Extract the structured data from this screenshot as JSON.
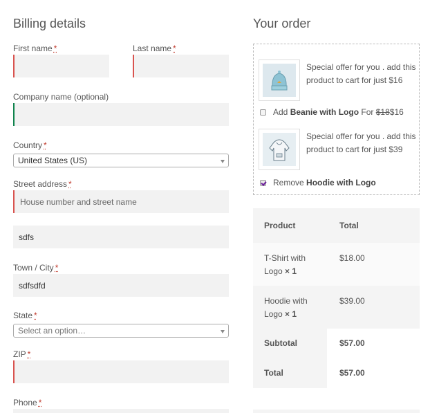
{
  "billing": {
    "title": "Billing details",
    "req_mark": "*",
    "first_name": {
      "label": "First name",
      "value": ""
    },
    "last_name": {
      "label": "Last name",
      "value": ""
    },
    "company": {
      "label": "Company name (optional)",
      "value": ""
    },
    "country": {
      "label": "Country",
      "value": "United States (US)"
    },
    "street": {
      "label": "Street address",
      "placeholder": "House number and street name",
      "line2_value": "sdfs"
    },
    "city": {
      "label": "Town / City",
      "value": "sdfsdfd"
    },
    "state": {
      "label": "State",
      "placeholder": "Select an option…"
    },
    "zip": {
      "label": "ZIP",
      "value": ""
    },
    "phone": {
      "label": "Phone"
    }
  },
  "order": {
    "title": "Your order",
    "offers": [
      {
        "text": "Special offer for you . add this product to cart for just $16",
        "action": "Add",
        "product": "Beanie with Logo",
        "for_word": "For",
        "old_price": "$18",
        "new_price": "$16",
        "checked": false,
        "icon": "beanie-image"
      },
      {
        "text": "Special offer for you . add this product to cart for just $39",
        "action": "Remove",
        "product": "Hoodie with Logo",
        "checked": true,
        "icon": "hoodie-image"
      }
    ],
    "table": {
      "head": {
        "product": "Product",
        "total": "Total"
      },
      "items": [
        {
          "name_line1": "T-Shirt with",
          "name_line2": "Logo",
          "qty": "× 1",
          "total": "$18.00"
        },
        {
          "name_line1": "Hoodie with",
          "name_line2": "Logo",
          "qty": "× 1",
          "total": "$39.00"
        }
      ],
      "subtotal_label": "Subtotal",
      "subtotal": "$57.00",
      "total_label": "Total",
      "total": "$57.00"
    }
  },
  "colors": {
    "error_border": "#d9534f",
    "ok_border": "#0f834d",
    "field_bg": "#f2f2f2",
    "check_mark": "#6a1b9a"
  }
}
